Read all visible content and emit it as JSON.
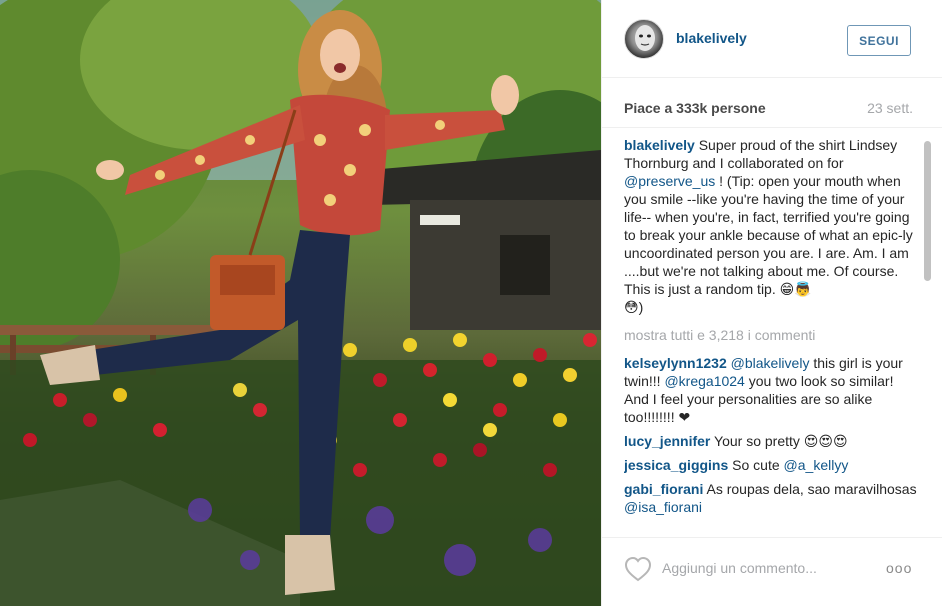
{
  "post": {
    "username": "blakelively",
    "follow_label": "SEGUI",
    "likes_text": "Piace a 333k persone",
    "date": "23 sett."
  },
  "caption": {
    "user": "blakelively",
    "part1": " Super proud of the shirt Lindsey Thornburg and I collaborated on for ",
    "mention": "@preserve_us",
    "part2": " ! (Tip: open your mouth when you smile --like you're having the time of your life-- when you're, in fact, terrified you're going to break your ankle because of what an epic-ly uncoordinated person you are. I are. Am. I am ....but we're not talking about me. Of course. This is just a random tip. 😁👼",
    "part3": "😳)"
  },
  "show_all_comments": "mostra tutti e 3,218 i commenti",
  "comments": [
    {
      "user": "kelseylynn1232",
      "mention1": "@blakelively",
      "text1": " this girl is your twin!!! ",
      "mention2": "@krega1024",
      "text2": " you two look so similar! And I feel your personalities are so alike too!!!!!!!! ❤"
    },
    {
      "user": "lucy_jennifer",
      "text": " Your so pretty 😍😍😍"
    },
    {
      "user": "jessica_giggins",
      "text": " So cute ",
      "mention": "@a_kellyy"
    },
    {
      "user": "gabi_fiorani",
      "text": " As roupas dela, sao maravilhosas ",
      "mention": "@isa_fiorani"
    }
  ],
  "footer": {
    "comment_placeholder": "Aggiungi un commento...",
    "more_label": "ooo"
  },
  "icons": {
    "like": "heart-outline-icon",
    "more": "more-options-icon"
  },
  "colors": {
    "link_blue": "#125688",
    "follow_blue": "#3f729b",
    "muted_gray": "#a5a7aa"
  }
}
